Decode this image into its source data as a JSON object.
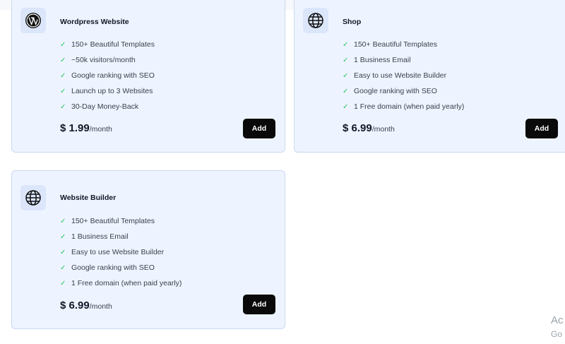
{
  "plans": [
    {
      "title": "Wordpress Website",
      "icon": "wordpress-icon",
      "features": [
        "150+ Beautiful Templates",
        "~50k visitors/month",
        "Google ranking with SEO",
        "Launch up to 3 Websites",
        "30-Day Money-Back"
      ],
      "price": "$ 1.99",
      "price_unit": "/month",
      "button_label": "Add"
    },
    {
      "title": "Shop",
      "icon": "globe-icon",
      "features": [
        "150+ Beautiful Templates",
        "1 Business Email",
        "Easy to use Website Builder",
        "Google ranking with SEO",
        "1 Free domain (when paid yearly)"
      ],
      "price": "$ 6.99",
      "price_unit": "/month",
      "button_label": "Add"
    },
    {
      "title": "Website Builder",
      "icon": "globe-icon",
      "features": [
        "150+ Beautiful Templates",
        "1 Business Email",
        "Easy to use Website Builder",
        "Google ranking with SEO",
        "1 Free domain (when paid yearly)"
      ],
      "price": "$ 6.99",
      "price_unit": "/month",
      "button_label": "Add"
    }
  ],
  "check_glyph": "✓",
  "watermark": {
    "line1": "Ac",
    "line2": "Go"
  },
  "colors": {
    "card_bg": "#eef4ff",
    "card_border": "#c9d8ef",
    "check": "#22c55e",
    "button_bg": "#0a0a0a"
  }
}
